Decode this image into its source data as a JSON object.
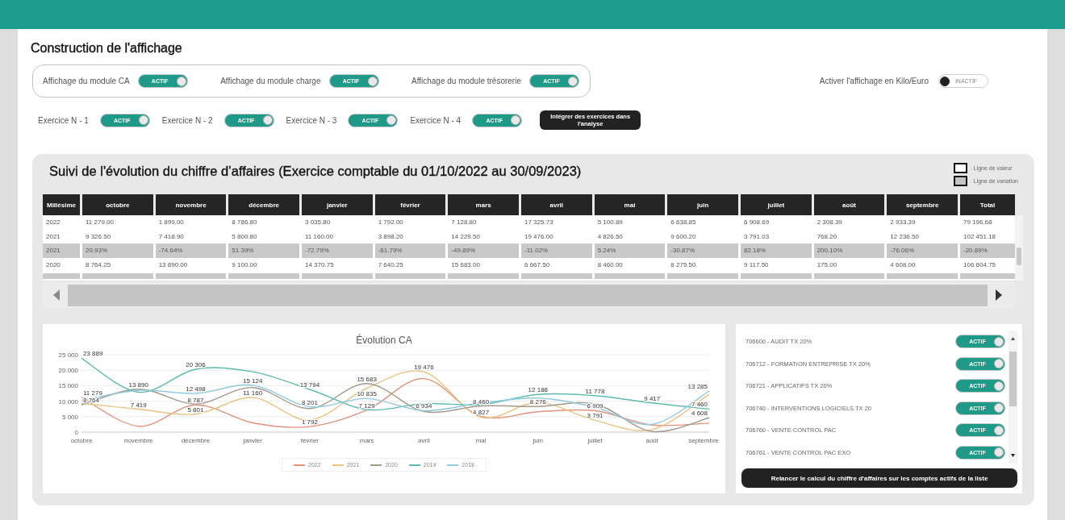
{
  "display": {
    "title": "Construction de l'affichage",
    "modules": [
      {
        "label": "Affichage du module CA",
        "toggle_text": "ACTIF",
        "on": true
      },
      {
        "label": "Affichage du module charge",
        "toggle_text": "ACTIF",
        "on": true
      },
      {
        "label": "Affichage du module trésorerie",
        "toggle_text": "ACTIF",
        "on": true
      }
    ],
    "kilo_euro": {
      "label": "Activer l'affichage en Kilo/Euro",
      "toggle_text": "INACTIF",
      "on": false
    },
    "exercises": [
      {
        "label": "Exercice N - 1",
        "toggle_text": "ACTIF",
        "on": true
      },
      {
        "label": "Exercice N - 2",
        "toggle_text": "ACTIF",
        "on": true
      },
      {
        "label": "Exercice N - 3",
        "toggle_text": "ACTIF",
        "on": true
      },
      {
        "label": "Exercice N - 4",
        "toggle_text": "ACTIF",
        "on": true
      }
    ],
    "integrate_button": "Intégrer des exercices dans l'analyse"
  },
  "revenue_tracking": {
    "title": "Suivi de l'évolution du chiffre d’affaires (Exercice comptable du 01/10/2022 au 30/09/2023)",
    "legend": [
      {
        "label": "Ligne de valeur",
        "kind": "value"
      },
      {
        "label": "Ligne de variation",
        "kind": "variation"
      }
    ],
    "table": {
      "columns": [
        "Millésime",
        "octobre",
        "novembre",
        "décembre",
        "janvier",
        "février",
        "mars",
        "avril",
        "mai",
        "juin",
        "juillet",
        "août",
        "septembre",
        "Total"
      ],
      "rows": [
        {
          "kind": "value",
          "cells": [
            "2022",
            "11 279.00",
            "1 899.00",
            "8 786.80",
            "3 035.80",
            "1 792.00",
            "7 128.80",
            "17 325.73",
            "5 100.89",
            "6 638.85",
            "6 908.69",
            "2 308.39",
            "2 933.39",
            "79 196.68"
          ]
        },
        {
          "kind": "value",
          "cells": [
            "2021",
            "9 326.50",
            "7 418.90",
            "5 800.80",
            "11 160.00",
            "3 898.20",
            "14 229.50",
            "19 476.00",
            "4 826.50",
            "9 600.20",
            "3 791.03",
            "768.20",
            "12 236.50",
            "102 451.18"
          ]
        },
        {
          "kind": "variation",
          "cells": [
            "2021",
            "20.93%",
            "-74.64%",
            "51.39%",
            "-72.79%",
            "-61.79%",
            "-49.89%",
            "-11.02%",
            "5.24%",
            "-30.87%",
            "82.18%",
            "200.10%",
            "-76.06%",
            "-20.89%"
          ]
        },
        {
          "kind": "value",
          "cells": [
            "2020",
            "8 764.25",
            "13 890.00",
            "9 100.00",
            "14 370.75",
            "7 640.25",
            "15 683.00",
            "6 667.50",
            "8 460.00",
            "8 275.50",
            "9 117.50",
            "175.00",
            "4 608.00",
            "106 604.75"
          ]
        },
        {
          "kind": "variation"
        }
      ]
    },
    "chart": {
      "chart_data": {
        "type": "line",
        "title": "Évolution CA",
        "categories": [
          "octobre",
          "novembre",
          "décembre",
          "janvier",
          "février",
          "mars",
          "avril",
          "mai",
          "juin",
          "juillet",
          "août",
          "septembre"
        ],
        "ylim": [
          0,
          25000
        ],
        "grid": true,
        "legend": true,
        "yticks": [
          {
            "value": 0,
            "label": "0"
          },
          {
            "value": 5000,
            "label": "5 000"
          },
          {
            "value": 10000,
            "label": "10 000"
          },
          {
            "value": 15000,
            "label": "15 000"
          },
          {
            "value": 20000,
            "label": "20 000"
          },
          {
            "value": 25000,
            "label": "25 000"
          }
        ],
        "series": [
          {
            "name": "2022",
            "color": "#e3927c",
            "values": [
              11279,
              1900,
              8787,
              3000,
              1792,
              7129,
              17300,
              5100,
              6600,
              6909,
              2300,
              2900
            ]
          },
          {
            "name": "2021",
            "color": "#e8c47e",
            "values": [
              9300,
              7419,
              5801,
              11160,
              3900,
              14200,
              19476,
              4827,
              9600,
              3791,
              800,
              12200
            ]
          },
          {
            "name": "2020",
            "color": "#a39a8c",
            "values": [
              8764,
              13890,
              9100,
              14400,
              7600,
              15683,
              6700,
              8460,
              8276,
              9100,
              200,
              4608
            ]
          },
          {
            "name": "2019",
            "color": "#5cbcae",
            "values": [
              23889,
              12900,
              20306,
              19500,
              13794,
              7300,
              9200,
              8900,
              12188,
              11778,
              9417,
              7460
            ]
          },
          {
            "name": "2018",
            "color": "#8fcbe0",
            "values": [
              10200,
              13500,
              12498,
              15124,
              8201,
              10835,
              6934,
              9400,
              11000,
              8000,
              2500,
              13285
            ]
          }
        ],
        "value_labels": [
          [
            "11 279",
            null,
            "8 787",
            null,
            "1 792",
            "7 129",
            null,
            null,
            null,
            "6 909",
            null,
            null
          ],
          [
            null,
            "7 419",
            "5 801",
            "11 160",
            null,
            null,
            "19 476",
            "4 827",
            null,
            "3 791",
            null,
            null
          ],
          [
            "8 764",
            "13 890",
            null,
            null,
            null,
            "15 683",
            null,
            "8 460",
            "8 276",
            null,
            null,
            "4 608"
          ],
          [
            "23 889",
            null,
            "20 306",
            null,
            "13 794",
            null,
            null,
            null,
            "12 188",
            "11 778",
            "9 417",
            "7 460"
          ],
          [
            null,
            null,
            "12 498",
            "15 124",
            "8 201",
            "10 835",
            "6 934",
            null,
            null,
            null,
            null,
            "13 285"
          ]
        ]
      }
    },
    "accounts": {
      "items": [
        {
          "label": "706600 - AUDIT TX 20%",
          "toggle_text": "ACTIF",
          "on": true
        },
        {
          "label": "706712 - FORMATION ENTREPRISE TX 20%",
          "toggle_text": "ACTIF",
          "on": true
        },
        {
          "label": "706721 - APPLICATIFS TX 20%",
          "toggle_text": "ACTIF",
          "on": true
        },
        {
          "label": "706740 - INTERVENTIONS LOGICIELS TX 20",
          "toggle_text": "ACTIF",
          "on": true
        },
        {
          "label": "706760 - VENTE CONTROL PAC",
          "toggle_text": "ACTIF",
          "on": true
        },
        {
          "label": "706761 - VENTE CONTROL PAC EXO",
          "toggle_text": "ACTIF",
          "on": true
        }
      ],
      "button": "Relancer le calcul du chiffre d'affaires sur les comptes actifs de la liste"
    }
  }
}
